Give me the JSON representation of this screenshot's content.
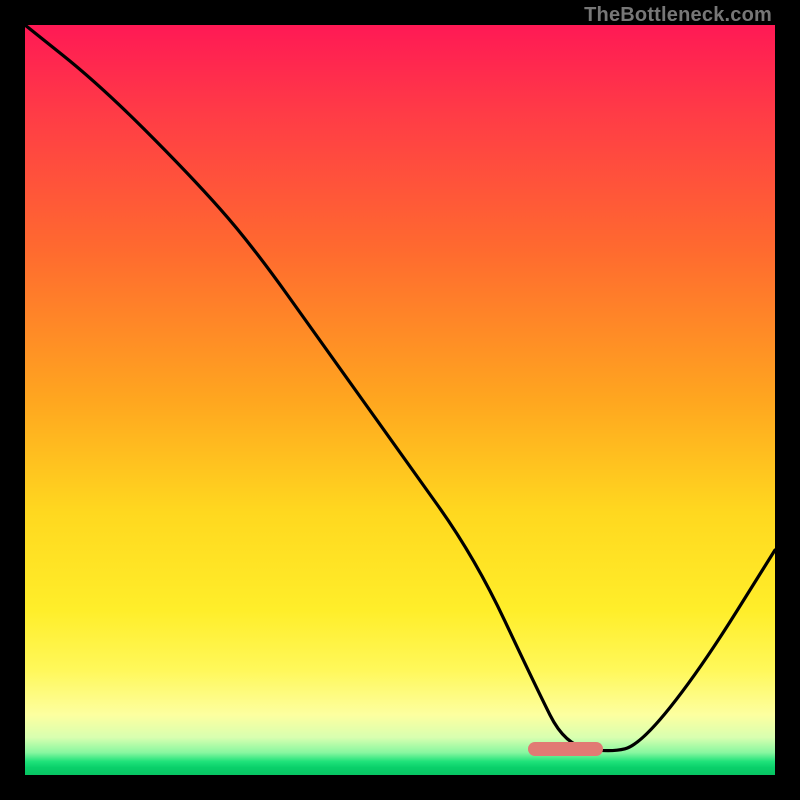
{
  "attribution": "TheBottleneck.com",
  "colors": {
    "frame": "#000000",
    "gradient_top": "#ff1955",
    "gradient_mid_orange": "#ff8a20",
    "gradient_mid_yellow": "#ffe020",
    "gradient_pale": "#fdffa0",
    "gradient_green": "#0ad06a",
    "curve": "#000000",
    "marker": "#e17a74"
  },
  "marker": {
    "x_frac": 0.72,
    "y_frac": 0.965,
    "w_frac": 0.1,
    "h_frac": 0.018
  },
  "chart_data": {
    "type": "line",
    "title": "",
    "xlabel": "",
    "ylabel": "",
    "xlim": [
      0,
      100
    ],
    "ylim": [
      0,
      100
    ],
    "series": [
      {
        "name": "bottleneck-curve",
        "x": [
          0,
          10,
          22,
          30,
          40,
          50,
          60,
          68,
          72,
          78,
          82,
          90,
          100
        ],
        "y": [
          100,
          92,
          80,
          71,
          57,
          43,
          29,
          12,
          4,
          3,
          4,
          14,
          30
        ]
      }
    ],
    "marker_region": {
      "x_start": 72,
      "x_end": 82,
      "y": 3
    },
    "annotations": []
  }
}
